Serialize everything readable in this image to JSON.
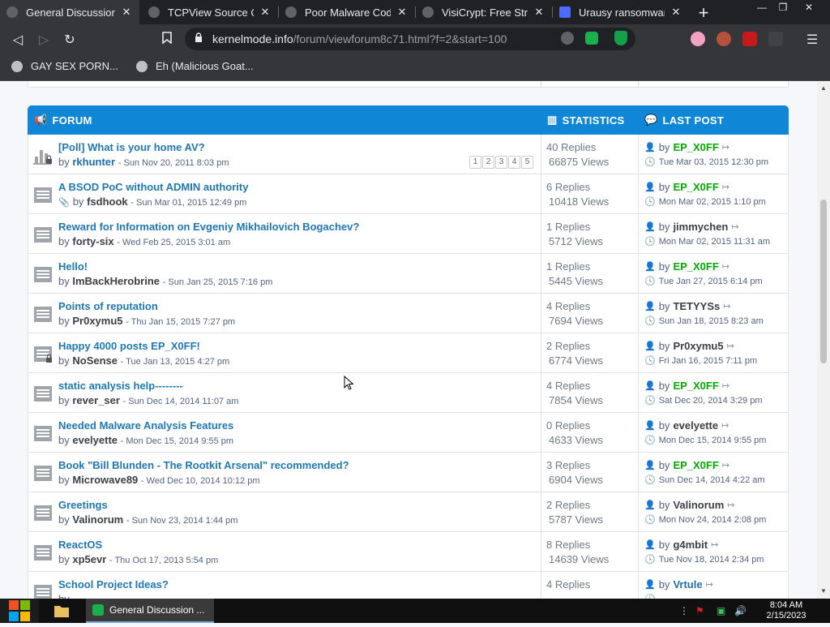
{
  "browser": {
    "tabs": [
      {
        "label": "General Discussion -",
        "active": true
      },
      {
        "label": "TCPView Source Co",
        "active": false
      },
      {
        "label": "Poor Malware Coding",
        "active": false
      },
      {
        "label": "VisiCrypt: Free Stron",
        "active": false
      },
      {
        "label": "Urausy ransomware",
        "active": false
      }
    ],
    "url_domain": "kernelmode.info",
    "url_path": "/forum/viewforum8c71.html?f=2&start=100",
    "bookmarks": [
      "GAY SEX PORN...",
      "Eh (Malicious Goat..."
    ]
  },
  "forum_header": {
    "forum": "FORUM",
    "statistics": "STATISTICS",
    "last_post": "LAST POST"
  },
  "topics": [
    {
      "title": "[Poll] What is your home AV?",
      "by": "by",
      "author": "rkhunter",
      "date": "Sun Nov 20, 2011 8:03 pm",
      "pages": [
        "1",
        "2",
        "3",
        "4",
        "5"
      ],
      "replies": "40 Replies",
      "views": "66875 Views",
      "lp_by": "by",
      "lp_user": "EP_X0FF",
      "lp_date": "Tue Mar 03, 2015 12:30 pm"
    },
    {
      "title": "A BSOD PoC without ADMIN authority",
      "by": "by",
      "author": "fsdhook",
      "date": "Sun Mar 01, 2015 12:49 pm",
      "replies": "6 Replies",
      "views": "10418 Views",
      "lp_by": "by",
      "lp_user": "EP_X0FF",
      "lp_date": "Mon Mar 02, 2015 1:10 pm"
    },
    {
      "title": "Reward for Information on Evgeniy Mikhailovich Bogachev?",
      "by": "by",
      "author": "forty-six",
      "date": "Wed Feb 25, 2015 3:01 am",
      "replies": "1 Replies",
      "views": "5712 Views",
      "lp_by": "by",
      "lp_user": "jimmychen",
      "lp_date": "Mon Mar 02, 2015 11:31 am"
    },
    {
      "title": "Hello!",
      "by": "by",
      "author": "ImBackHerobrine",
      "date": "Sun Jan 25, 2015 7:16 pm",
      "replies": "1 Replies",
      "views": "5445 Views",
      "lp_by": "by",
      "lp_user": "EP_X0FF",
      "lp_date": "Tue Jan 27, 2015 6:14 pm"
    },
    {
      "title": "Points of reputation",
      "by": "by",
      "author": "Pr0xymu5",
      "date": "Thu Jan 15, 2015 7:27 pm",
      "replies": "4 Replies",
      "views": "7694 Views",
      "lp_by": "by",
      "lp_user": "TETYYSs",
      "lp_date": "Sun Jan 18, 2015 8:23 am"
    },
    {
      "title": "Happy 4000 posts EP_X0FF!",
      "by": "by",
      "author": "NoSense",
      "date": "Tue Jan 13, 2015 4:27 pm",
      "replies": "2 Replies",
      "views": "6774 Views",
      "lp_by": "by",
      "lp_user": "Pr0xymu5",
      "lp_date": "Fri Jan 16, 2015 7:11 pm"
    },
    {
      "title": "static analysis help--------",
      "by": "by",
      "author": "rever_ser",
      "date": "Sun Dec 14, 2014 11:07 am",
      "replies": "4 Replies",
      "views": "7854 Views",
      "lp_by": "by",
      "lp_user": "EP_X0FF",
      "lp_date": "Sat Dec 20, 2014 3:29 pm"
    },
    {
      "title": "Needed Malware Analysis Features",
      "by": "by",
      "author": "evelyette",
      "date": "Mon Dec 15, 2014 9:55 pm",
      "replies": "0 Replies",
      "views": "4633 Views",
      "lp_by": "by",
      "lp_user": "evelyette",
      "lp_date": "Mon Dec 15, 2014 9:55 pm"
    },
    {
      "title": "Book \"Bill Blunden - The Rootkit Arsenal\" recommended?",
      "by": "by",
      "author": "Microwave89",
      "date": "Wed Dec 10, 2014 10:12 pm",
      "replies": "3 Replies",
      "views": "6904 Views",
      "lp_by": "by",
      "lp_user": "EP_X0FF",
      "lp_date": "Sun Dec 14, 2014 4:22 am"
    },
    {
      "title": "Greetings",
      "by": "by",
      "author": "Valinorum",
      "date": "Sun Nov 23, 2014 1:44 pm",
      "replies": "2 Replies",
      "views": "5787 Views",
      "lp_by": "by",
      "lp_user": "Valinorum",
      "lp_date": "Mon Nov 24, 2014 2:08 pm"
    },
    {
      "title": "ReactOS",
      "by": "by",
      "author": "xp5evr",
      "date": "Thu Oct 17, 2013 5:54 pm",
      "replies": "8 Replies",
      "views": "14639 Views",
      "lp_by": "by",
      "lp_user": "g4mbit",
      "lp_date": "Tue Nov 18, 2014 2:34 pm"
    },
    {
      "title": "School Project Ideas?",
      "by": "by",
      "author": "",
      "date": "",
      "replies": "4 Replies",
      "views": "",
      "lp_by": "by",
      "lp_user": "Vrtule",
      "lp_date": ""
    }
  ],
  "taskbar": {
    "item": "General Discussion ...",
    "time": "8:04 AM",
    "date": "2/15/2023"
  },
  "colors": {
    "header_blue": "#0f87d6",
    "link_blue": "#1f78b4",
    "admin_green": "#00aa00"
  }
}
